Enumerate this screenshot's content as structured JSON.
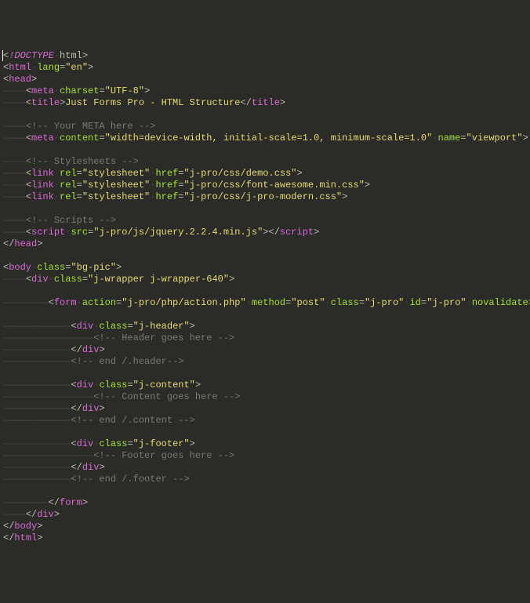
{
  "lines": [
    {
      "indent": 0,
      "type": "doctype",
      "text": "!DOCTYPE",
      "after": "html"
    },
    {
      "indent": 0,
      "type": "open",
      "tag": "html",
      "attrs": [
        {
          "n": "lang",
          "v": "en"
        }
      ]
    },
    {
      "indent": 0,
      "type": "open",
      "tag": "head",
      "attrs": []
    },
    {
      "indent": 1,
      "type": "selfclose",
      "tag": "meta",
      "attrs": [
        {
          "n": "charset",
          "v": "UTF-8"
        }
      ]
    },
    {
      "indent": 1,
      "type": "openclose",
      "tag": "title",
      "inner": "Just Forms Pro - HTML Structure"
    },
    {
      "indent": 0,
      "type": "blank"
    },
    {
      "indent": 1,
      "type": "comment",
      "text": "<!-- Your META here -->"
    },
    {
      "indent": 1,
      "type": "selfclose",
      "tag": "meta",
      "attrs": [
        {
          "n": "content",
          "v": "width=device-width, initial-scale=1.0, minimum-scale=1.0"
        },
        {
          "n": "name",
          "v": "viewport"
        }
      ]
    },
    {
      "indent": 0,
      "type": "blank"
    },
    {
      "indent": 1,
      "type": "comment",
      "text": "<!-- Stylesheets -->"
    },
    {
      "indent": 1,
      "type": "selfclose",
      "tag": "link",
      "attrs": [
        {
          "n": "rel",
          "v": "stylesheet"
        },
        {
          "n": "href",
          "v": "j-pro/css/demo.css"
        }
      ]
    },
    {
      "indent": 1,
      "type": "selfclose",
      "tag": "link",
      "attrs": [
        {
          "n": "rel",
          "v": "stylesheet"
        },
        {
          "n": "href",
          "v": "j-pro/css/font-awesome.min.css"
        }
      ]
    },
    {
      "indent": 1,
      "type": "selfclose",
      "tag": "link",
      "attrs": [
        {
          "n": "rel",
          "v": "stylesheet"
        },
        {
          "n": "href",
          "v": "j-pro/css/j-pro-modern.css"
        }
      ]
    },
    {
      "indent": 0,
      "type": "blank"
    },
    {
      "indent": 1,
      "type": "comment",
      "text": "<!-- Scripts -->"
    },
    {
      "indent": 1,
      "type": "openclose",
      "tag": "script",
      "attrs": [
        {
          "n": "src",
          "v": "j-pro/js/jquery.2.2.4.min.js"
        }
      ],
      "inner": ""
    },
    {
      "indent": 0,
      "type": "close",
      "tag": "head"
    },
    {
      "indent": 0,
      "type": "blank"
    },
    {
      "indent": 0,
      "type": "open",
      "tag": "body",
      "attrs": [
        {
          "n": "class",
          "v": "bg-pic"
        }
      ]
    },
    {
      "indent": 1,
      "type": "open",
      "tag": "div",
      "attrs": [
        {
          "n": "class",
          "v": "j-wrapper j-wrapper-640"
        }
      ]
    },
    {
      "indent": 0,
      "type": "blank"
    },
    {
      "indent": 2,
      "type": "open",
      "tag": "form",
      "attrs": [
        {
          "n": "action",
          "v": "j-pro/php/action.php"
        },
        {
          "n": "method",
          "v": "post"
        },
        {
          "n": "class",
          "v": "j-pro"
        },
        {
          "n": "id",
          "v": "j-pro"
        },
        {
          "n": "novalidate",
          "v": null
        }
      ]
    },
    {
      "indent": 0,
      "type": "blank"
    },
    {
      "indent": 3,
      "type": "open",
      "tag": "div",
      "attrs": [
        {
          "n": "class",
          "v": "j-header"
        }
      ]
    },
    {
      "indent": 4,
      "type": "comment",
      "text": "<!-- Header goes here -->"
    },
    {
      "indent": 3,
      "type": "close",
      "tag": "div"
    },
    {
      "indent": 3,
      "type": "comment",
      "text": "<!-- end /.header-->"
    },
    {
      "indent": 0,
      "type": "blank"
    },
    {
      "indent": 3,
      "type": "open",
      "tag": "div",
      "attrs": [
        {
          "n": "class",
          "v": "j-content"
        }
      ]
    },
    {
      "indent": 4,
      "type": "comment",
      "text": "<!-- Content goes here -->"
    },
    {
      "indent": 3,
      "type": "close",
      "tag": "div"
    },
    {
      "indent": 3,
      "type": "comment",
      "text": "<!-- end /.content -->"
    },
    {
      "indent": 0,
      "type": "blank"
    },
    {
      "indent": 3,
      "type": "open",
      "tag": "div",
      "attrs": [
        {
          "n": "class",
          "v": "j-footer"
        }
      ]
    },
    {
      "indent": 4,
      "type": "comment",
      "text": "<!-- Footer goes here -->"
    },
    {
      "indent": 3,
      "type": "close",
      "tag": "div"
    },
    {
      "indent": 3,
      "type": "comment",
      "text": "<!-- end /.footer -->"
    },
    {
      "indent": 0,
      "type": "blank"
    },
    {
      "indent": 2,
      "type": "close",
      "tag": "form"
    },
    {
      "indent": 1,
      "type": "close",
      "tag": "div"
    },
    {
      "indent": 0,
      "type": "close",
      "tag": "body"
    },
    {
      "indent": 0,
      "type": "close",
      "tag": "html"
    }
  ],
  "indent_unit": "————",
  "attr_sep": "·"
}
